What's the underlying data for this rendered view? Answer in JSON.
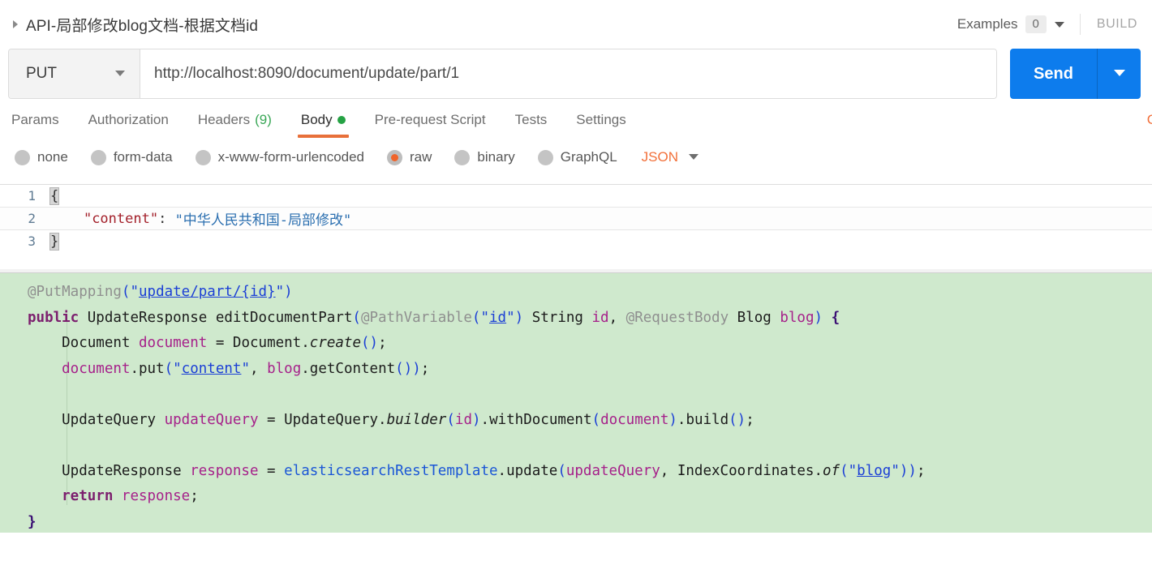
{
  "header": {
    "collapse_icon": "triangle-right-icon",
    "title": "API-局部修改blog文档-根据文档id",
    "examples_label": "Examples",
    "examples_count": "0",
    "examples_caret_icon": "chevron-down-icon",
    "build_label": "BUILD"
  },
  "request": {
    "method": "PUT",
    "method_caret_icon": "chevron-down-icon",
    "url": "http://localhost:8090/document/update/part/1",
    "send_label": "Send",
    "send_caret_icon": "chevron-down-icon"
  },
  "tabs": {
    "items": [
      {
        "label": "Params",
        "count": "",
        "active": false
      },
      {
        "label": "Authorization",
        "count": "",
        "active": false
      },
      {
        "label": "Headers",
        "count": "(9)",
        "active": false
      },
      {
        "label": "Body",
        "count": "",
        "active": true
      },
      {
        "label": "Pre-request Script",
        "count": "",
        "active": false
      },
      {
        "label": "Tests",
        "count": "",
        "active": false
      },
      {
        "label": "Settings",
        "count": "",
        "active": false
      }
    ],
    "right_link": "C"
  },
  "body_type": {
    "options": [
      {
        "label": "none",
        "selected": false
      },
      {
        "label": "form-data",
        "selected": false
      },
      {
        "label": "x-www-form-urlencoded",
        "selected": false
      },
      {
        "label": "raw",
        "selected": true
      },
      {
        "label": "binary",
        "selected": false
      },
      {
        "label": "GraphQL",
        "selected": false
      }
    ],
    "format": "JSON",
    "format_caret_icon": "chevron-down-icon"
  },
  "editor": {
    "line_numbers": [
      "1",
      "2",
      "3"
    ],
    "line1_brace": "{",
    "line2_key": "\"content\"",
    "line2_colon": ": ",
    "line2_value": "\"中华人民共和国-局部修改\"",
    "line3_brace": "}"
  },
  "snippet": {
    "lines": [
      "@PutMapping(\"update/part/{id}\")",
      "public UpdateResponse editDocumentPart(@PathVariable(\"id\") String id, @RequestBody Blog blog) {",
      "    Document document = Document.create();",
      "    document.put(\"content\", blog.getContent());",
      "",
      "    UpdateQuery updateQuery = UpdateQuery.builder(id).withDocument(document).build();",
      "",
      "    UpdateResponse response = elasticsearchRestTemplate.update(updateQuery, IndexCoordinates.of(\"blog\"));",
      "    return response;",
      "}"
    ]
  },
  "colors": {
    "accent_orange": "#f0642a",
    "send_blue": "#0d7ced",
    "tab_green": "#25a244",
    "snippet_bg": "#cfe9cd"
  }
}
